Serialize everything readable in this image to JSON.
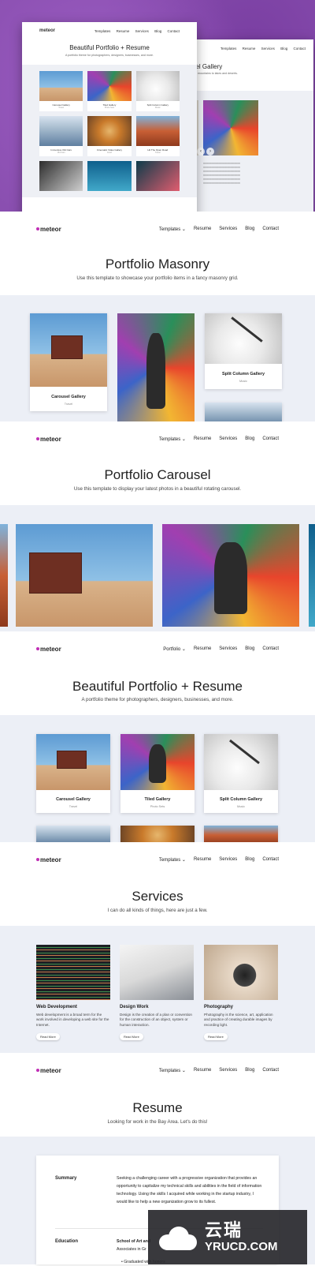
{
  "brand": {
    "logo": "meteor",
    "accent": "#c02fb5"
  },
  "nav": {
    "templates": "Templates",
    "portfolio": "Portfolio",
    "chevron": "⌄",
    "resume": "Resume",
    "services": "Services",
    "blog": "Blog",
    "contact": "Contact"
  },
  "hero": {
    "front_title": "Beautiful Portfolio + Resume",
    "front_sub": "A portfolio theme for photographers, designers, businesses, and more.",
    "back_title": "usel Gallery",
    "back_sub": "g from mountains to lakes and deserts.",
    "mini_cards": [
      {
        "title": "Carousel Gallery",
        "cat": "Travel"
      },
      {
        "title": "Tiled Gallery",
        "cat": "Photo Sets"
      },
      {
        "title": "Split Column Gallery",
        "cat": "Music"
      },
      {
        "title": "Immersive Old Cars",
        "cat": "Old Cars"
      },
      {
        "title": "Cinematic Video Gallery",
        "cat": "Food"
      },
      {
        "title": "Hit The Open Road",
        "cat": "Travel"
      }
    ]
  },
  "masonry": {
    "title": "Portfolio Masonry",
    "subtitle": "Use this template to showcase your portfolio items in a fancy masonry grid.",
    "cards": [
      {
        "title": "Carousel Gallery",
        "cat": "Travel"
      },
      {
        "title": "Split Column Gallery",
        "cat": "Music"
      }
    ]
  },
  "carousel": {
    "title": "Portfolio Carousel",
    "subtitle": "Use this template to display your latest photos in a beautiful rotating carousel."
  },
  "portfolio": {
    "title": "Beautiful Portfolio + Resume",
    "subtitle": "A portfolio theme for photographers, designers, businesses, and more.",
    "cards": [
      {
        "title": "Carousel Gallery",
        "cat": "Travel"
      },
      {
        "title": "Tiled Gallery",
        "cat": "Photo Sets"
      },
      {
        "title": "Split Column Gallery",
        "cat": "Music"
      }
    ]
  },
  "services": {
    "title": "Services",
    "subtitle": "I can do all kinds of things, here are just a few.",
    "items": [
      {
        "title": "Web Development",
        "desc": "Web development is a broad term for the work involved in developing a web site for the Internet.",
        "button": "Read More"
      },
      {
        "title": "Design Work",
        "desc": "Design is the creation of a plan or convention for the construction of an object, system or human interaction.",
        "button": "Read More"
      },
      {
        "title": "Photography",
        "desc": "Photography is the science, art, application and practice of creating durable images by recording light.",
        "button": "Read More"
      }
    ]
  },
  "resume": {
    "title": "Resume",
    "subtitle": "Looking for work in the Bay Area. Let's do this!",
    "summary_label": "Summary",
    "summary_text": "Seeking a challenging career with a progressive organization that provides an opportunity to capitalize my technical skills and abilities in the field of information technology. Using the skills I acquired while working in the startup industry, I would like to help a new organization grow to its fullest.",
    "education_label": "Education",
    "education_school": "School of Art and",
    "education_line2": "Associates in Gr",
    "education_bullet": "Graduated with honors"
  },
  "watermark": {
    "cn": "云瑞",
    "en": "YRUCD.COM"
  }
}
